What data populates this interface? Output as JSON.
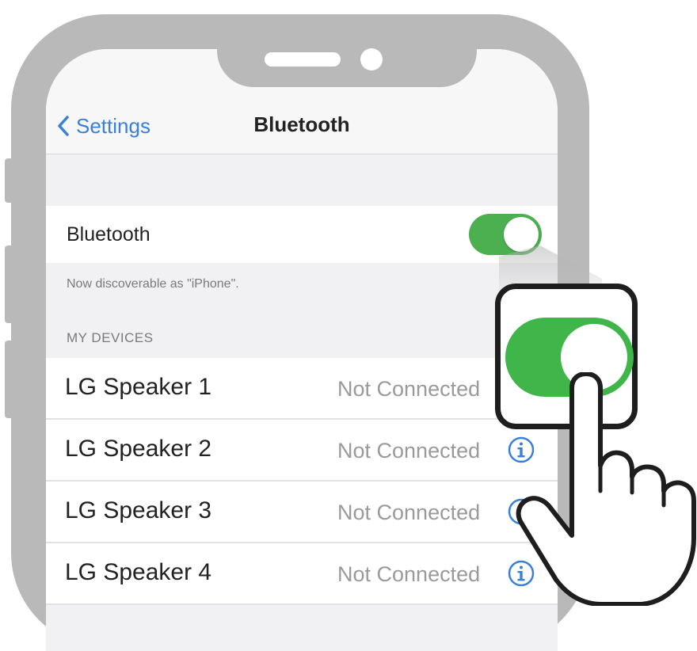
{
  "nav": {
    "back_label": "Settings",
    "title": "Bluetooth"
  },
  "bluetooth": {
    "label": "Bluetooth",
    "toggle_on": true,
    "discoverable_caption": "Now discoverable as \"iPhone\"."
  },
  "section": {
    "my_devices_header": "MY DEVICES"
  },
  "devices": [
    {
      "name": "LG Speaker 1",
      "status": "Not Connected"
    },
    {
      "name": "LG Speaker 2",
      "status": "Not Connected"
    },
    {
      "name": "LG Speaker 3",
      "status": "Not Connected"
    },
    {
      "name": "LG Speaker 4",
      "status": "Not Connected"
    }
  ],
  "icons": {
    "back": "chevron-left-icon",
    "info": "info-icon",
    "pointer": "hand-pointer-icon"
  },
  "colors": {
    "accent_blue": "#3a7fd8",
    "toggle_green": "#4caf50",
    "phone_frame": "#b9b9b9"
  }
}
